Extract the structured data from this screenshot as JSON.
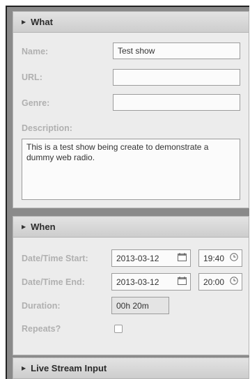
{
  "what": {
    "header": "What",
    "name_label": "Name:",
    "name_value": "Test show",
    "url_label": "URL:",
    "url_value": "",
    "genre_label": "Genre:",
    "genre_value": "",
    "description_label": "Description:",
    "description_value": "This is a test show being create to demonstrate a dummy web radio."
  },
  "when": {
    "header": "When",
    "start_label": "Date/Time Start:",
    "start_date": "2013-03-12",
    "start_time": "19:40",
    "end_label": "Date/Time End:",
    "end_date": "2013-03-12",
    "end_time": "20:00",
    "duration_label": "Duration:",
    "duration_value": "00h 20m",
    "repeats_label": "Repeats?",
    "repeats_checked": false
  },
  "live": {
    "header": "Live Stream Input"
  },
  "icons": {
    "collapse": "triangle-right-icon",
    "date": "calendar-icon",
    "time": "clock-icon"
  }
}
